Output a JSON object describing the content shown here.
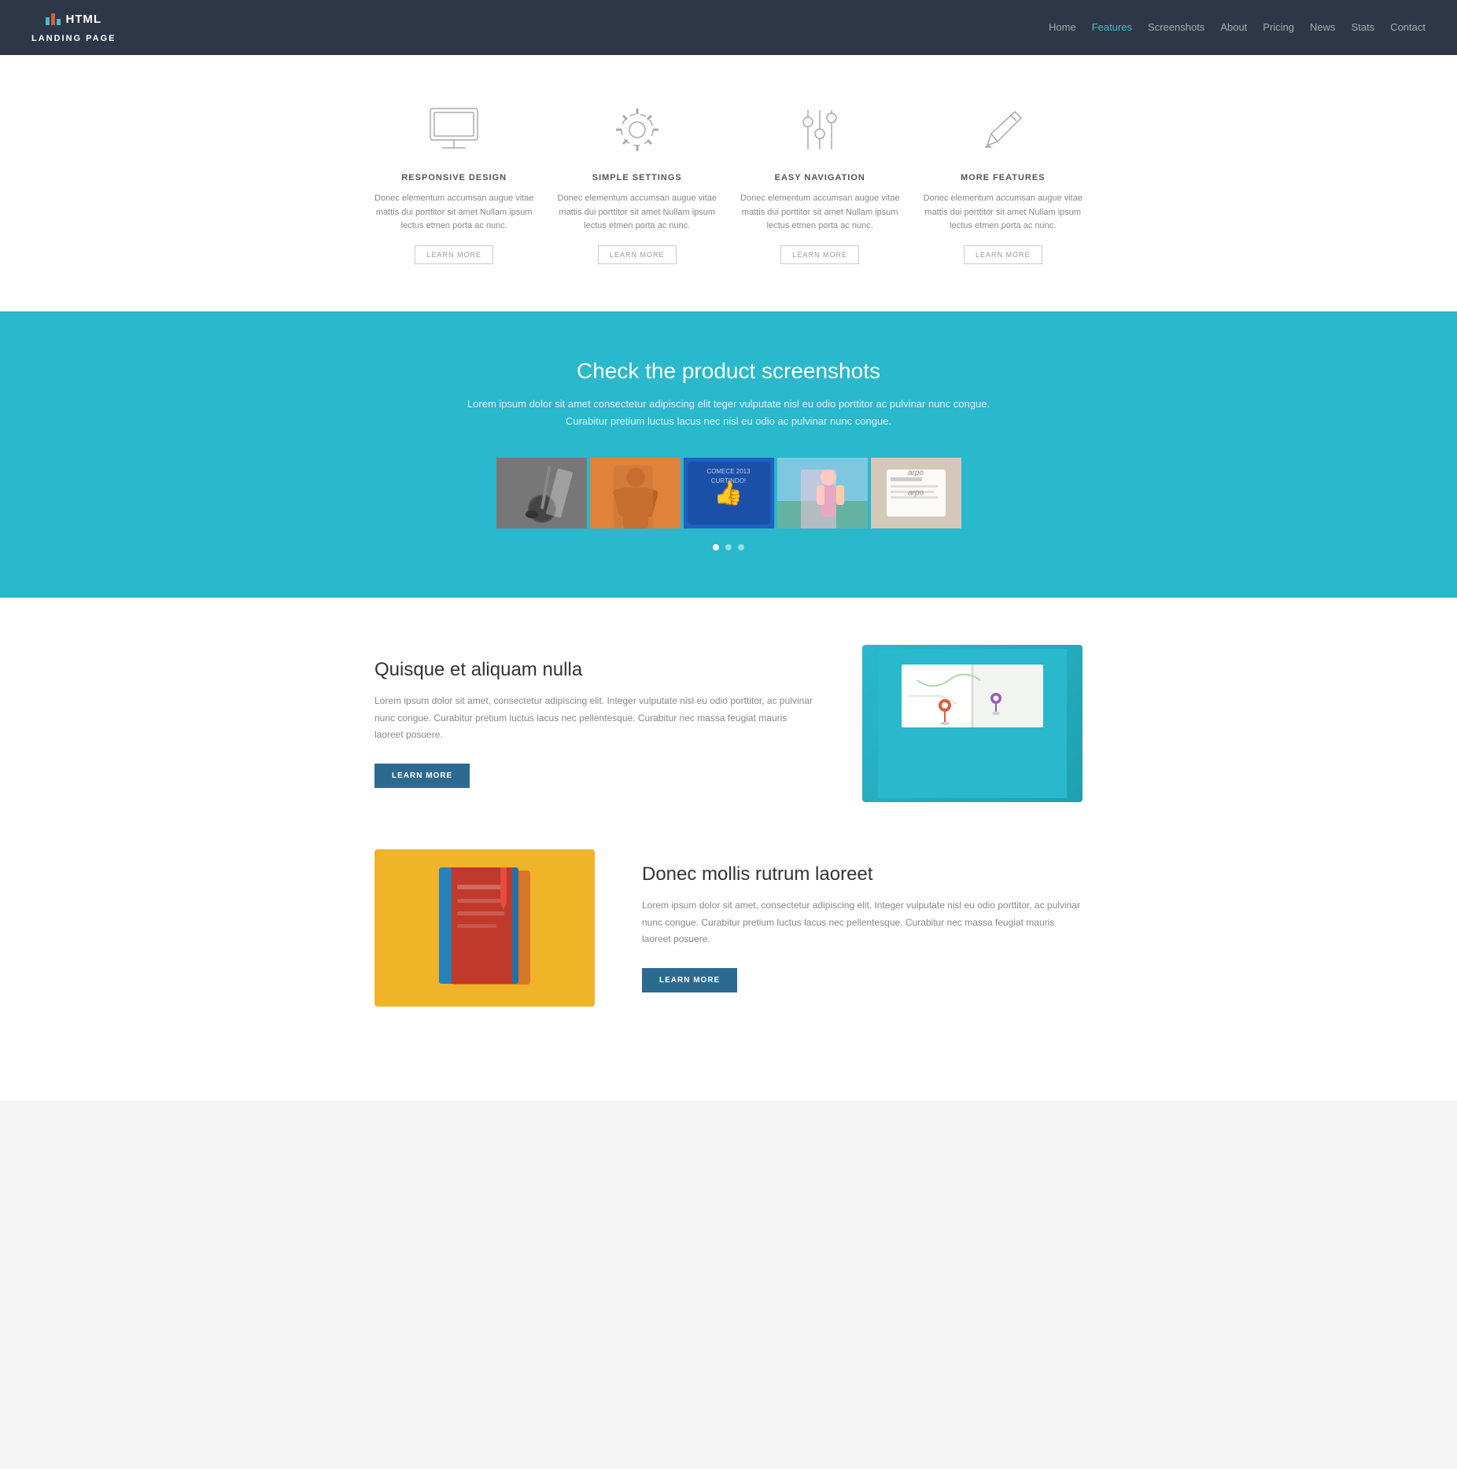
{
  "navbar": {
    "brand_name": "HTML",
    "brand_subtitle": "LANDING PAGE",
    "nav_items": [
      {
        "label": "Home",
        "active": false
      },
      {
        "label": "Features",
        "active": true
      },
      {
        "label": "Screenshots",
        "active": false
      },
      {
        "label": "About",
        "active": false
      },
      {
        "label": "Pricing",
        "active": false
      },
      {
        "label": "News",
        "active": false
      },
      {
        "label": "Stats",
        "active": false
      },
      {
        "label": "Contact",
        "active": false
      }
    ]
  },
  "features": {
    "items": [
      {
        "icon": "monitor",
        "title": "RESPONSIVE DESIGN",
        "text": "Donec elementum accumsan augue vitae mattis dui porttitor sit amet Nullam ipsum lectus etmen porta ac nunc.",
        "btn_label": "LEARN MORE"
      },
      {
        "icon": "settings",
        "title": "SIMPLE SETTINGS",
        "text": "Donec elementum accumsan augue vitae mattis dui porttitor sit amet Nullam ipsum lectus etmen porta ac nunc.",
        "btn_label": "LEARN MORE"
      },
      {
        "icon": "sliders",
        "title": "EASY NAVIGATION",
        "text": "Donec elementum accumsan augue vitae mattis dui porttitor sit amet Nullam ipsum lectus etmen porta ac nunc.",
        "btn_label": "LEARN MORE"
      },
      {
        "icon": "pencil",
        "title": "MORE FEATURES",
        "text": "Donec elementum accumsan augue vitae mattis dui porttitor sit amet Nullam ipsum lectus etmen porta ac nunc.",
        "btn_label": "LEARN MORE"
      }
    ]
  },
  "screenshots": {
    "title": "Check the product screenshots",
    "description": "Lorem ipsum dolor sit amet consectetur adipiscing elit teger vulputate nisl eu odio porttitor ac pulvinar nunc congue.\nCurabitur pretium luctus lacus nec nisl eu odio ac pulvinar nunc congue.",
    "gallery_items": [
      {
        "label": "Golf",
        "color": "#666"
      },
      {
        "label": "Person",
        "color": "#e0823a"
      },
      {
        "label": "Facebook",
        "color": "#3a8de0"
      },
      {
        "label": "Girl",
        "color": "#7dc8e0"
      },
      {
        "label": "Card",
        "color": "#d4c8bc"
      }
    ],
    "dots": [
      {
        "active": true
      },
      {
        "active": false
      },
      {
        "active": false
      }
    ]
  },
  "about": {
    "section1": {
      "title": "Quisque et aliquam nulla",
      "text": "Lorem ipsum dolor sit amet, consectetur adipiscing elit. Integer vulputate nisl eu odio porttitor, ac pulvinar nunc congue. Curabitur pretium luctus lacus nec pellentesque. Curabitur nec massa feugiat mauris laoreet posuere.",
      "btn_label": "LEARN MORE"
    },
    "section2": {
      "title": "Donec mollis rutrum laoreet",
      "text": "Lorem ipsum dolor sit amet, consectetur adipiscing elit. Integer vulputate nisl eu odio porttitor, ac pulvinar nunc congue. Curabitur pretium luctus lacus nec pellentesque. Curabitur nec massa feugiat mauris laoreet posuere.",
      "btn_label": "LEARN MORE"
    }
  }
}
